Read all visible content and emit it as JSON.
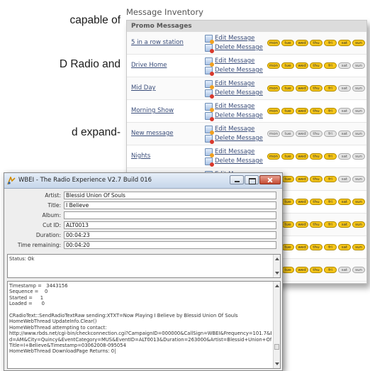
{
  "document_text": {
    "line1": "capable of",
    "line2": "D Radio and",
    "line3": "d expand-"
  },
  "inventory": {
    "title": "Message Inventory",
    "section": "Promo Messages",
    "edit_label": "Edit Message",
    "delete_label": "Delete Message",
    "day_labels": [
      "mon",
      "tue",
      "wed",
      "thu",
      "fri",
      "sat",
      "sun"
    ],
    "active_day_color": "#f5c518",
    "inactive_day_color": "#e4e4e4",
    "rows": [
      {
        "station": "5 in a row station",
        "days": [
          true,
          true,
          true,
          true,
          true,
          true,
          true
        ]
      },
      {
        "station": "Drive Home",
        "days": [
          true,
          true,
          true,
          true,
          true,
          false,
          false
        ]
      },
      {
        "station": "Mid Day",
        "days": [
          true,
          true,
          true,
          true,
          true,
          false,
          false
        ]
      },
      {
        "station": "Morning Show",
        "days": [
          true,
          true,
          true,
          true,
          true,
          false,
          false
        ]
      },
      {
        "station": "New message",
        "days": [
          false,
          false,
          false,
          false,
          false,
          false,
          false
        ]
      },
      {
        "station": "Nights",
        "days": [
          true,
          true,
          true,
          true,
          true,
          false,
          false
        ]
      },
      {
        "station": "",
        "days": [
          true,
          true,
          true,
          true,
          true,
          false,
          false
        ]
      },
      {
        "station": "",
        "days": [
          true,
          true,
          true,
          true,
          true,
          true,
          true
        ]
      },
      {
        "station": "",
        "days": [
          true,
          true,
          true,
          true,
          true,
          true,
          true
        ]
      },
      {
        "station": "",
        "days": [
          true,
          true,
          true,
          true,
          true,
          true,
          true
        ]
      },
      {
        "station": "",
        "days": [
          true,
          true,
          true,
          true,
          true,
          false,
          false
        ]
      }
    ]
  },
  "window": {
    "title": "WBEI - The Radio Experience V2.7 Build 016",
    "fields": {
      "artist_label": "Artist:",
      "artist": "Blessid Union Of Souls",
      "title_label": "Title:",
      "title": "I Believe",
      "album_label": "Album:",
      "album": "",
      "cutid_label": "Cut ID:",
      "cutid": "ALT0013",
      "duration_label": "Duration:",
      "duration": "00:04:23",
      "remaining_label": "Time remaining:",
      "remaining": "00:04:20"
    },
    "status": "Status: Ok",
    "log": "Timestamp =   3443156\nSequence =    0\nStarted =     1\nLoaded =      0\n\nCRadioText::SendRadioTextRaw sending:XTXT=Now Playing I Believe by Blessid Union Of Souls\nHomeWebThread UpdateInfo.Clear()\nHomeWebThread attempting to contact:\nhttp://www.rbds.net/cgi-bin/checkconnection.cgi?CampaignID=000000&CallSign=WBEI&Frequency=101.7&Ban\nd=AM&City=Quincy&EventCategory=MUS&EventID=ALT0013&Duration=263000&Artist=Blessid+Union+Of+Souls&\nTitle=I+Believe&Timestamp=03062008-095054\nHomeWebThread DownloadPage Returns: 0|"
  }
}
